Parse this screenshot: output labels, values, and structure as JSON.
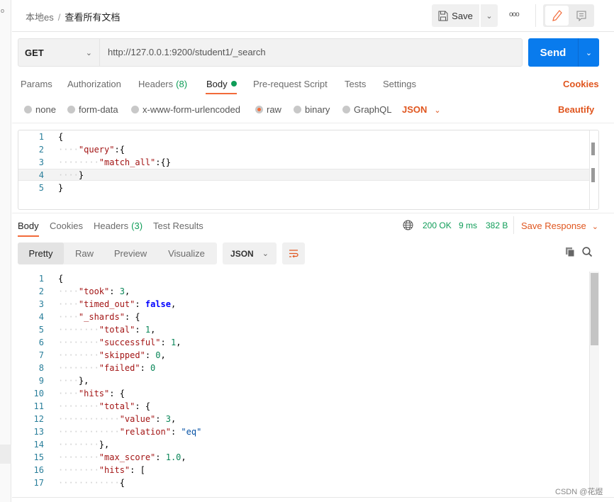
{
  "header": {
    "parent": "本地es",
    "separator": "/",
    "title": "查看所有文档",
    "save_label": "Save",
    "more_label": "ooo"
  },
  "request": {
    "method": "GET",
    "url": "http://127.0.0.1:9200/student1/_search",
    "send_label": "Send"
  },
  "req_tabs": [
    {
      "label": "Params"
    },
    {
      "label": "Authorization"
    },
    {
      "label": "Headers",
      "count": "(8)"
    },
    {
      "label": "Body"
    },
    {
      "label": "Pre-request Script"
    },
    {
      "label": "Tests"
    },
    {
      "label": "Settings"
    }
  ],
  "cookies_label": "Cookies",
  "body_types": [
    {
      "label": "none"
    },
    {
      "label": "form-data"
    },
    {
      "label": "x-www-form-urlencoded"
    },
    {
      "label": "raw",
      "selected": true
    },
    {
      "label": "binary"
    },
    {
      "label": "GraphQL"
    }
  ],
  "body_format": "JSON",
  "beautify_label": "Beautify",
  "request_body": [
    [
      [
        "{",
        "p"
      ]
    ],
    [
      [
        "····",
        "g"
      ],
      [
        "\"query\"",
        "k"
      ],
      [
        ":",
        "p"
      ],
      [
        "{",
        "p"
      ]
    ],
    [
      [
        "········",
        "g"
      ],
      [
        "\"match_all\"",
        "k"
      ],
      [
        ":",
        "p"
      ],
      [
        "{}",
        "p"
      ]
    ],
    [
      [
        "····",
        "g"
      ],
      [
        "}",
        "p"
      ]
    ],
    [
      [
        "}",
        "p"
      ]
    ]
  ],
  "resp_tabs": [
    {
      "label": "Body"
    },
    {
      "label": "Cookies"
    },
    {
      "label": "Headers",
      "count": "(3)"
    },
    {
      "label": "Test Results"
    }
  ],
  "status": {
    "code": "200 OK",
    "time": "9 ms",
    "size": "382 B",
    "save_response": "Save Response"
  },
  "view_modes": [
    "Pretty",
    "Raw",
    "Preview",
    "Visualize"
  ],
  "resp_format": "JSON",
  "colors": {
    "accent": "#f26b3a",
    "send": "#097bed",
    "ok": "#0cbb52"
  },
  "response_body": [
    [
      [
        "{",
        "p"
      ]
    ],
    [
      [
        "····",
        "g"
      ],
      [
        "\"took\"",
        "k"
      ],
      [
        ": ",
        "p"
      ],
      [
        "3",
        "n"
      ],
      [
        ",",
        "p"
      ]
    ],
    [
      [
        "····",
        "g"
      ],
      [
        "\"timed_out\"",
        "k"
      ],
      [
        ": ",
        "p"
      ],
      [
        "false",
        "b"
      ],
      [
        ",",
        "p"
      ]
    ],
    [
      [
        "····",
        "g"
      ],
      [
        "\"_shards\"",
        "k"
      ],
      [
        ": {",
        "p"
      ]
    ],
    [
      [
        "········",
        "g"
      ],
      [
        "\"total\"",
        "k"
      ],
      [
        ": ",
        "p"
      ],
      [
        "1",
        "n"
      ],
      [
        ",",
        "p"
      ]
    ],
    [
      [
        "········",
        "g"
      ],
      [
        "\"successful\"",
        "k"
      ],
      [
        ": ",
        "p"
      ],
      [
        "1",
        "n"
      ],
      [
        ",",
        "p"
      ]
    ],
    [
      [
        "········",
        "g"
      ],
      [
        "\"skipped\"",
        "k"
      ],
      [
        ": ",
        "p"
      ],
      [
        "0",
        "n"
      ],
      [
        ",",
        "p"
      ]
    ],
    [
      [
        "········",
        "g"
      ],
      [
        "\"failed\"",
        "k"
      ],
      [
        ": ",
        "p"
      ],
      [
        "0",
        "n"
      ]
    ],
    [
      [
        "····",
        "g"
      ],
      [
        "},",
        "p"
      ]
    ],
    [
      [
        "····",
        "g"
      ],
      [
        "\"hits\"",
        "k"
      ],
      [
        ": {",
        "p"
      ]
    ],
    [
      [
        "········",
        "g"
      ],
      [
        "\"total\"",
        "k"
      ],
      [
        ": {",
        "p"
      ]
    ],
    [
      [
        "············",
        "g"
      ],
      [
        "\"value\"",
        "k"
      ],
      [
        ": ",
        "p"
      ],
      [
        "3",
        "n"
      ],
      [
        ",",
        "p"
      ]
    ],
    [
      [
        "············",
        "g"
      ],
      [
        "\"relation\"",
        "k"
      ],
      [
        ": ",
        "p"
      ],
      [
        "\"eq\"",
        "s"
      ]
    ],
    [
      [
        "········",
        "g"
      ],
      [
        "},",
        "p"
      ]
    ],
    [
      [
        "········",
        "g"
      ],
      [
        "\"max_score\"",
        "k"
      ],
      [
        ": ",
        "p"
      ],
      [
        "1.0",
        "n"
      ],
      [
        ",",
        "p"
      ]
    ],
    [
      [
        "········",
        "g"
      ],
      [
        "\"hits\"",
        "k"
      ],
      [
        ": [",
        "p"
      ]
    ],
    [
      [
        "············",
        "g"
      ],
      [
        "{",
        "p"
      ]
    ]
  ],
  "watermark": "CSDN @花煜"
}
